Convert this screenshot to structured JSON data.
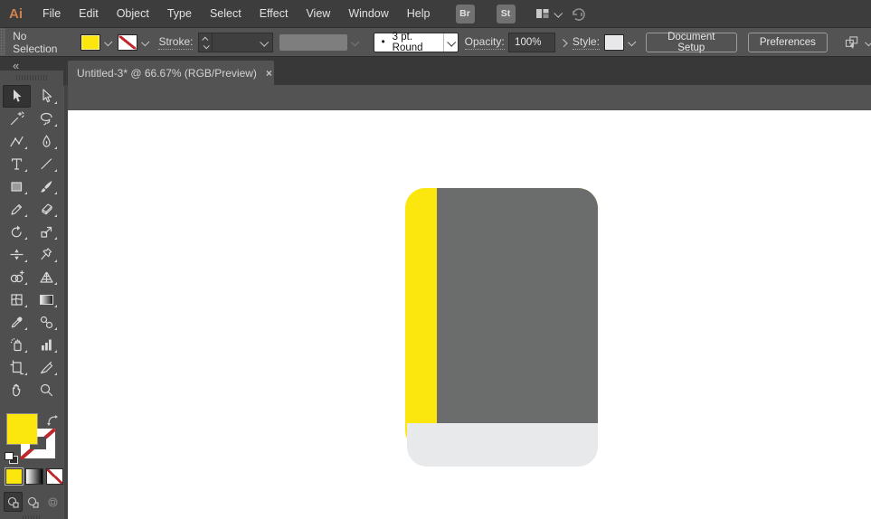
{
  "colors": {
    "accent_yellow": "#FBE70D",
    "book_cover_gray": "#6B6C6C",
    "book_pages_gray": "#E8E9EA",
    "menubar_bg": "#3D3D3D",
    "controlbar_bg": "#535353",
    "tabbar_bg": "#383838",
    "panel_bg": "#4F4F4F",
    "canvas_white": "#FFFFFF",
    "logo_orange": "#D2824F",
    "none_slash_red": "#C0272D"
  },
  "menu_bar": {
    "logo": "Ai",
    "items": [
      "File",
      "Edit",
      "Object",
      "Type",
      "Select",
      "Effect",
      "View",
      "Window",
      "Help"
    ],
    "bridge_button": "Br",
    "stock_button": "St"
  },
  "control_bar": {
    "selection_status": "No Selection",
    "fill_swatch": "yellow",
    "stroke_swatch": "none",
    "stroke_label": "Stroke:",
    "brush_dot": "•",
    "brush_preset": "3 pt. Round",
    "opacity_label": "Opacity:",
    "opacity_value": "100%",
    "style_label": "Style:",
    "document_setup_button": "Document Setup",
    "preferences_button": "Preferences"
  },
  "tab_bar": {
    "collapse_icon": "«",
    "active_tab_title": "Untitled-3* @ 66.67% (RGB/Preview)",
    "close_icon": "×"
  },
  "toolbar": {
    "tool_names": [
      "selection",
      "direct-selection",
      "magic-wand",
      "lasso",
      "curvature",
      "pen",
      "type",
      "line-segment",
      "rectangle",
      "paintbrush",
      "shaper",
      "eraser",
      "rotate",
      "scale",
      "width",
      "free-transform",
      "shape-builder",
      "perspective-grid",
      "mesh",
      "gradient",
      "eyedropper",
      "blend",
      "symbol-sprayer",
      "column-graph",
      "artboard",
      "slice",
      "hand",
      "zoom"
    ],
    "active_tool": "selection",
    "fill_indicator": "yellow",
    "stroke_indicator": "none",
    "color_mode_buttons": [
      "color",
      "gradient",
      "none"
    ],
    "active_color_mode": "color",
    "drawing_modes": [
      "draw-normal",
      "draw-behind",
      "draw-inside"
    ],
    "active_drawing_mode": "draw-normal"
  },
  "canvas": {
    "artwork": {
      "type": "book-icon",
      "spine_color": "#FBE70D",
      "cover_color": "#6B6C6C",
      "pages_color": "#E8E9EA"
    }
  }
}
